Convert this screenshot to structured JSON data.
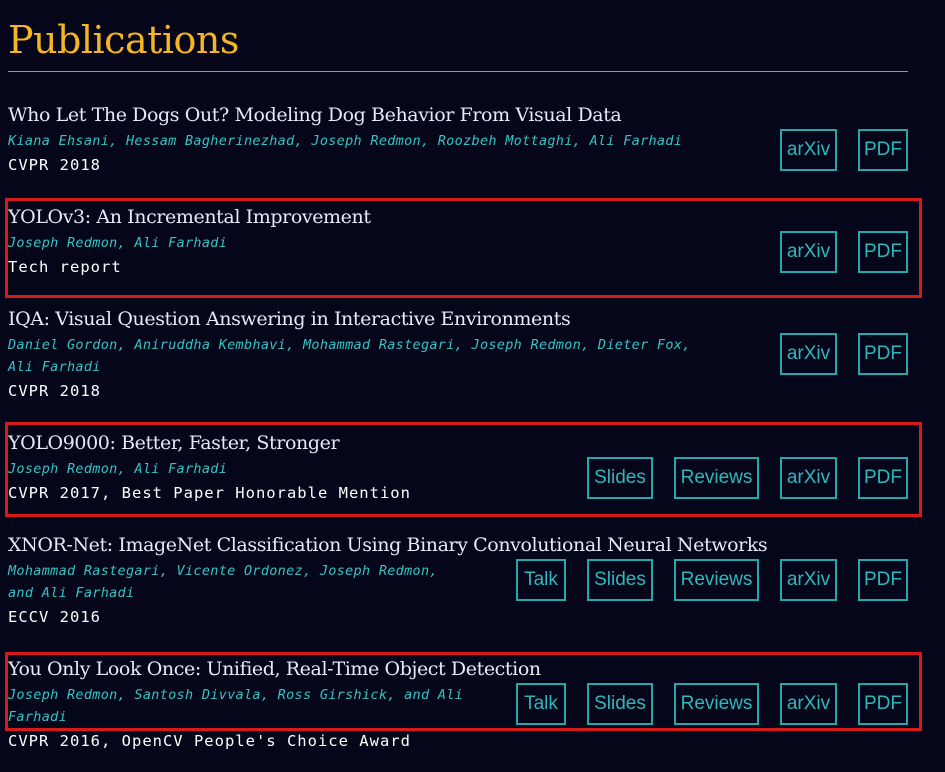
{
  "page": {
    "title": "Publications"
  },
  "publications": [
    {
      "title": "Who Let The Dogs Out? Modeling Dog Behavior From Visual Data",
      "authors": [
        "Kiana Ehsani, Hessam Bagherinezhad, Joseph Redmon, Roozbeh Mottaghi, Ali Farhadi"
      ],
      "venue": "CVPR 2018",
      "buttons": [
        "arXiv",
        "PDF"
      ],
      "highlighted": false
    },
    {
      "title": "YOLOv3: An Incremental Improvement",
      "authors": [
        "Joseph Redmon, Ali Farhadi"
      ],
      "venue": "Tech report",
      "buttons": [
        "arXiv",
        "PDF"
      ],
      "highlighted": true
    },
    {
      "title": "IQA: Visual Question Answering in Interactive Environments",
      "authors": [
        "Daniel Gordon, Aniruddha Kembhavi, Mohammad Rastegari, Joseph Redmon, Dieter Fox,",
        "Ali Farhadi"
      ],
      "venue": "CVPR 2018",
      "buttons": [
        "arXiv",
        "PDF"
      ],
      "highlighted": false
    },
    {
      "title": "YOLO9000: Better, Faster, Stronger",
      "authors": [
        "Joseph Redmon, Ali Farhadi"
      ],
      "venue": "CVPR 2017, Best Paper Honorable Mention",
      "buttons": [
        "Slides",
        "Reviews",
        "arXiv",
        "PDF"
      ],
      "highlighted": true
    },
    {
      "title": "XNOR-Net: ImageNet Classification Using Binary Convolutional Neural Networks",
      "authors": [
        "Mohammad Rastegari, Vicente Ordonez, Joseph Redmon,",
        "and Ali Farhadi"
      ],
      "venue": "ECCV 2016",
      "buttons": [
        "Talk",
        "Slides",
        "Reviews",
        "arXiv",
        "PDF"
      ],
      "highlighted": false
    },
    {
      "title": "You Only Look Once: Unified, Real-Time Object Detection",
      "authors": [
        "Joseph Redmon, Santosh Divvala, Ross Girshick, and Ali",
        "Farhadi"
      ],
      "venue": "CVPR 2016, OpenCV People's Choice Award",
      "buttons": [
        "Talk",
        "Slides",
        "Reviews",
        "arXiv",
        "PDF"
      ],
      "highlighted": true
    }
  ],
  "colors": {
    "background": "#05061a",
    "heading": "#f5b522",
    "authors": "#33c4c4",
    "button": "#23a9ad",
    "highlight": "#d61a1a"
  }
}
